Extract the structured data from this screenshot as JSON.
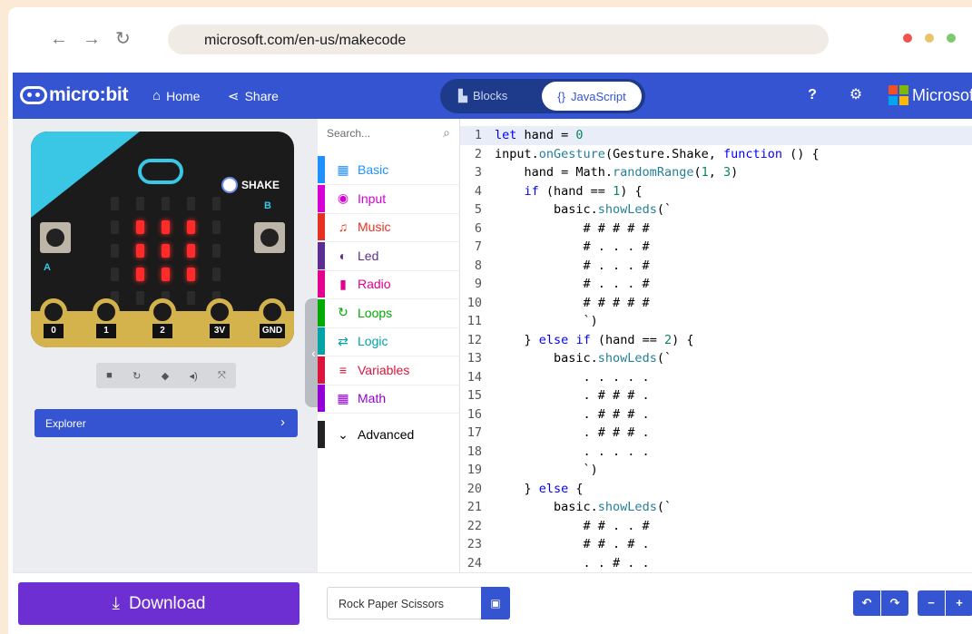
{
  "browser": {
    "back": "←",
    "forward": "→",
    "reload": "↻",
    "url": "microsoft.com/en-us/makecode",
    "dots": [
      "#ef5350",
      "#e9c46a",
      "#7cc96f"
    ]
  },
  "header": {
    "logo": "micro:bit",
    "home": "Home",
    "share": "Share",
    "blocks": "Blocks",
    "javascript": "JavaScript",
    "brand": "Microsoft"
  },
  "simulator": {
    "shake": "SHAKE",
    "button_a": "A",
    "button_b": "B",
    "pins": [
      "0",
      "1",
      "2",
      "3V",
      "GND"
    ],
    "leds": [
      [
        0,
        0,
        0,
        0,
        0
      ],
      [
        0,
        1,
        1,
        1,
        0
      ],
      [
        0,
        1,
        1,
        1,
        0
      ],
      [
        0,
        1,
        1,
        1,
        0
      ],
      [
        0,
        0,
        0,
        0,
        0
      ]
    ],
    "explorer": "Explorer"
  },
  "toolbox": {
    "search_placeholder": "Search...",
    "categories": [
      {
        "label": "Basic",
        "color": "#1e90ff",
        "icon": "▦"
      },
      {
        "label": "Input",
        "color": "#d400d4",
        "icon": "◉"
      },
      {
        "label": "Music",
        "color": "#e63022",
        "icon": "♫"
      },
      {
        "label": "Led",
        "color": "#5c2d91",
        "icon": "◐"
      },
      {
        "label": "Radio",
        "color": "#e3008c",
        "icon": "▮"
      },
      {
        "label": "Loops",
        "color": "#00aa00",
        "icon": "↻"
      },
      {
        "label": "Logic",
        "color": "#00a4a6",
        "icon": "⇄"
      },
      {
        "label": "Variables",
        "color": "#dc143c",
        "icon": "≡"
      },
      {
        "label": "Math",
        "color": "#9400d3",
        "icon": "▦"
      }
    ],
    "advanced": "Advanced"
  },
  "code": [
    "let hand = 0",
    "input.onGesture(Gesture.Shake, function () {",
    "    hand = Math.randomRange(1, 3)",
    "    if (hand == 1) {",
    "        basic.showLeds(`",
    "            # # # # #",
    "            # . . . #",
    "            # . . . #",
    "            # . . . #",
    "            # # # # #",
    "            `)",
    "    } else if (hand == 2) {",
    "        basic.showLeds(`",
    "            . . . . .",
    "            . # # # .",
    "            . # # # .",
    "            . # # # .",
    "            . . . . .",
    "            `)",
    "    } else {",
    "        basic.showLeds(`",
    "            # # . . #",
    "            # # . # .",
    "            . . # . ."
  ],
  "bottom": {
    "download": "Download",
    "project_name": "Rock Paper Scissors"
  }
}
